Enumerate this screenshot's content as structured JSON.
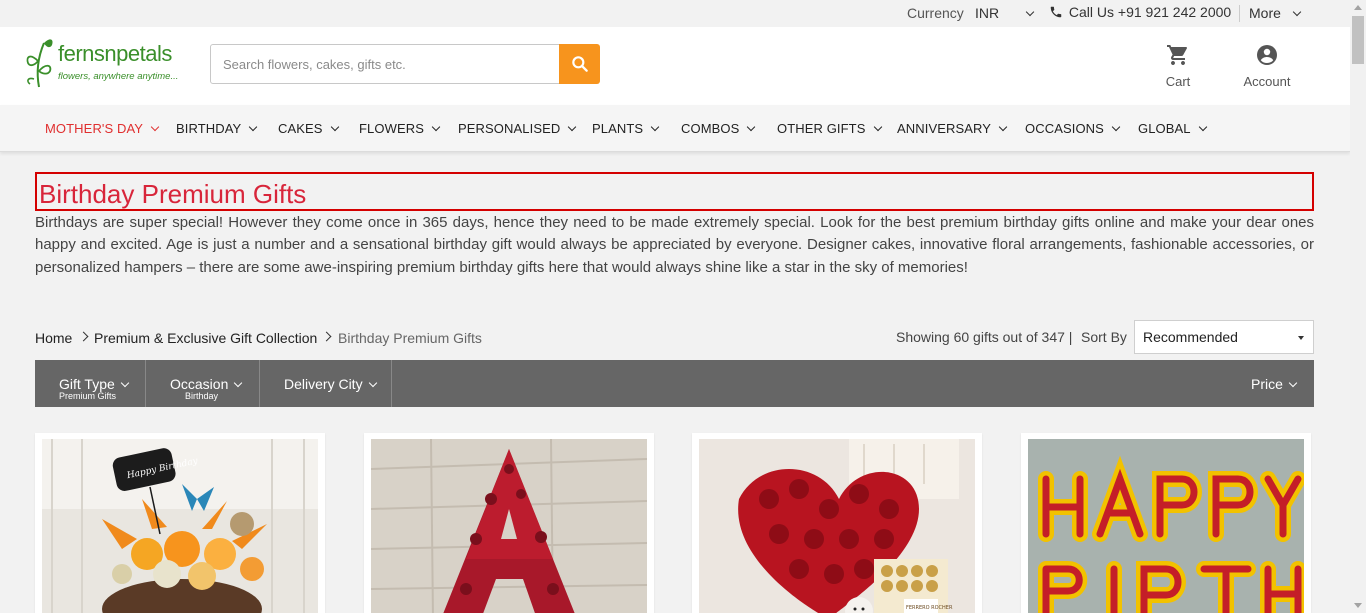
{
  "topbar": {
    "currency_label": "Currency",
    "currency_value": "INR",
    "call_us": "Call Us +91 921 242 2000",
    "more": "More"
  },
  "brand": {
    "logo_text": "fernsnpetals",
    "tagline": "flowers, anywhere anytime...",
    "color": "#3a8f2a"
  },
  "search": {
    "placeholder": "Search flowers, cakes, gifts etc.",
    "button_color": "#f7941d"
  },
  "header_icons": {
    "cart": "Cart",
    "account": "Account"
  },
  "nav": {
    "items": [
      {
        "label": "MOTHER'S DAY",
        "active": true
      },
      {
        "label": "BIRTHDAY"
      },
      {
        "label": "CAKES"
      },
      {
        "label": "FLOWERS"
      },
      {
        "label": "PERSONALISED"
      },
      {
        "label": "PLANTS"
      },
      {
        "label": "COMBOS"
      },
      {
        "label": "OTHER GIFTS"
      },
      {
        "label": "ANNIVERSARY"
      },
      {
        "label": "OCCASIONS"
      },
      {
        "label": "GLOBAL"
      }
    ],
    "active_color": "#e02f2f"
  },
  "page": {
    "title": "Birthday Premium Gifts",
    "description": "Birthdays are super special! However they come once in 365 days, hence they need to be made extremely special. Look for the best premium birthday gifts online and make your dear ones happy and excited. Age is just a number and a sensational birthday gift would always be appreciated by everyone. Designer cakes, innovative floral arrangements, fashionable accessories, or personalized hampers – there are some awe-inspiring premium birthday gifts here that would always shine like a star in the sky of memories!"
  },
  "breadcrumb": [
    "Home",
    "Premium & Exclusive Gift Collection",
    "Birthday Premium Gifts"
  ],
  "results": {
    "showing": "Showing 60 gifts out of 347 |",
    "sort_label": "Sort By",
    "sort_value": "Recommended"
  },
  "filters": {
    "gift_type": {
      "label": "Gift Type",
      "sub": "Premium Gifts"
    },
    "occasion": {
      "label": "Occasion",
      "sub": "Birthday"
    },
    "delivery_city": {
      "label": "Delivery City"
    },
    "price": {
      "label": "Price"
    }
  },
  "products": [
    {
      "image": "orange lilies and roses arrangement with happy birthday tag"
    },
    {
      "image": "red rose letter A arrangement"
    },
    {
      "image": "red roses heart bouquet with Ferrero Rocher box and teddy"
    },
    {
      "image": "happy birthday flower letters in red and yellow"
    }
  ],
  "products_image_labels": {
    "tag": "Happy Birthday",
    "box": "FERRERO ROCHER"
  }
}
